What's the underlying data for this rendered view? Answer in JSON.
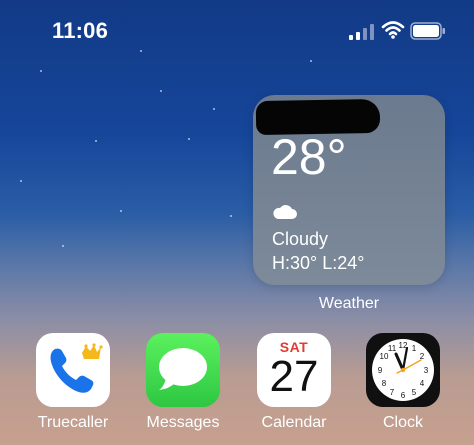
{
  "status_bar": {
    "time": "11:06",
    "icons": [
      "cellular-signal-icon",
      "wifi-icon",
      "battery-icon"
    ]
  },
  "weather_widget": {
    "temperature": "28°",
    "condition": "Cloudy",
    "high_low": "H:30° L:24°",
    "condition_icon": "cloud-icon",
    "label": "Weather",
    "location_redacted": true
  },
  "dock": {
    "apps": [
      {
        "label": "Truecaller",
        "icon": "truecaller-icon"
      },
      {
        "label": "Messages",
        "icon": "messages-icon"
      },
      {
        "label": "Calendar",
        "icon": "calendar-icon",
        "day": "SAT",
        "date": "27"
      },
      {
        "label": "Clock",
        "icon": "clock-icon"
      }
    ]
  },
  "colors": {
    "calendar_red": "#e33b30",
    "messages_green": "#34c759",
    "truecaller_blue": "#1a73e8",
    "clock_orange": "#f6a21a"
  }
}
